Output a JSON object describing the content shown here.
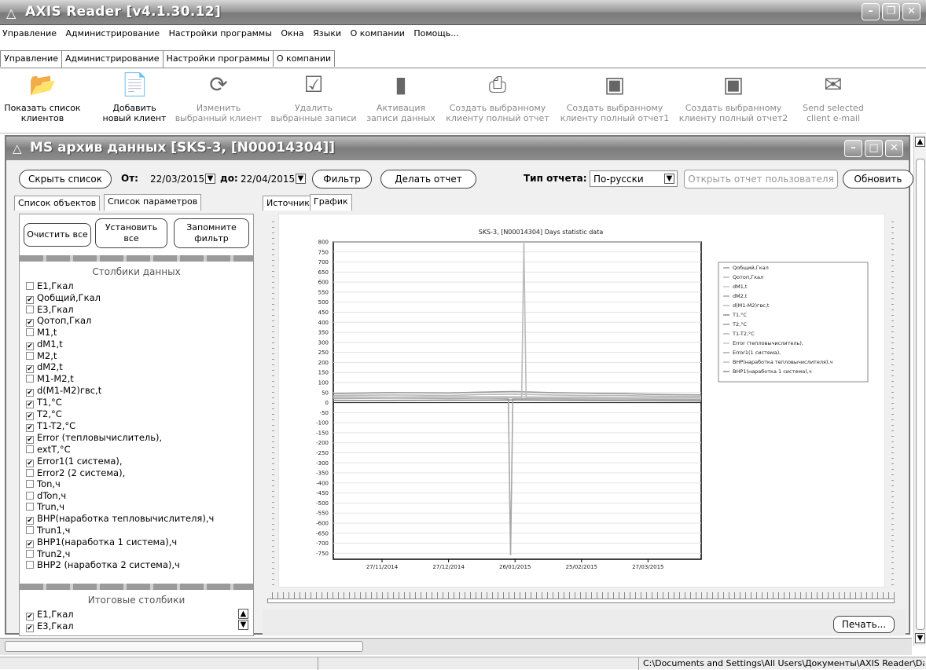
{
  "app": {
    "title": "AXIS Reader [v4.1.30.12]"
  },
  "menu": [
    "Управление",
    "Администрирование",
    "Настройки программы",
    "Окна",
    "Языки",
    "О компании",
    "Помощь..."
  ],
  "tabs": [
    "Управление",
    "Администрирование",
    "Настройки программы",
    "О компании"
  ],
  "ribbon": [
    {
      "l1": "Показать список",
      "l2": "клиентов",
      "icon": "folder-open-icon",
      "enabled": true
    },
    {
      "l1": "Добавить",
      "l2": "новый клиент",
      "icon": "document-add-icon",
      "enabled": true
    },
    {
      "l1": "Изменить",
      "l2": "выбранный клиент",
      "icon": "refresh-document-icon",
      "enabled": false
    },
    {
      "l1": "Удалить",
      "l2": "выбранные записи",
      "icon": "check-document-icon",
      "enabled": false
    },
    {
      "l1": "Активация",
      "l2": "записи данных",
      "icon": "activation-icon",
      "enabled": false
    },
    {
      "l1": "Создать выбранному",
      "l2": "клиенту полный отчет",
      "icon": "printer-icon",
      "enabled": false
    },
    {
      "l1": "Создать выбранному",
      "l2": "клиенту полный отчет1",
      "icon": "floppy-disk-icon",
      "enabled": false
    },
    {
      "l1": "Создать выбранному",
      "l2": "клиенту полный отчет2",
      "icon": "floppy-disk-icon",
      "enabled": false
    },
    {
      "l1": "Send selected",
      "l2": "client e-mail",
      "icon": "envelope-icon",
      "enabled": false
    }
  ],
  "child": {
    "title": "MS архив данных [SKS-3, [N00014304]]",
    "hide_list": "Скрыть список",
    "from_label": "От:",
    "from_date": "22/03/2015",
    "to_label": "до:",
    "to_date": "22/04/2015",
    "filter": "Фильтр",
    "make_report": "Делать отчет",
    "report_type_label": "Тип отчета:",
    "report_type": "По-русски",
    "open_user_report": "Открыть отчет пользователя",
    "refresh": "Обновить",
    "left_tabs": [
      "Список объектов",
      "Список параметров"
    ],
    "right_tabs": [
      "Источник",
      "График"
    ],
    "clear_all": "Очистить все",
    "set_all_1": "Установить",
    "set_all_2": "все",
    "remember_1": "Запомните",
    "remember_2": "фильтр",
    "data_columns_title": "Столбики данных",
    "params": [
      {
        "name": "E1,Гкал",
        "checked": false
      },
      {
        "name": "Qобщий,Гкал",
        "checked": true
      },
      {
        "name": "E3,Гкал",
        "checked": false
      },
      {
        "name": "Qотоп,Гкал",
        "checked": true
      },
      {
        "name": "M1,t",
        "checked": false
      },
      {
        "name": "dM1,t",
        "checked": true
      },
      {
        "name": "M2,t",
        "checked": false
      },
      {
        "name": "dM2,t",
        "checked": true
      },
      {
        "name": "M1-M2,t",
        "checked": false
      },
      {
        "name": "d(M1-M2)гвс,t",
        "checked": true
      },
      {
        "name": "T1,°C",
        "checked": true
      },
      {
        "name": "T2,°C",
        "checked": true
      },
      {
        "name": "T1-T2,°C",
        "checked": true
      },
      {
        "name": "Error (тепловычислитель),",
        "checked": true
      },
      {
        "name": "extT,°C",
        "checked": false
      },
      {
        "name": "Error1(1 система),",
        "checked": true
      },
      {
        "name": "Error2 (2 система),",
        "checked": false
      },
      {
        "name": "Ton,ч",
        "checked": false
      },
      {
        "name": "dTon,ч",
        "checked": false
      },
      {
        "name": "Trun,ч",
        "checked": false
      },
      {
        "name": "ВНР(наработка тепловычислителя),ч",
        "checked": true
      },
      {
        "name": "Trun1,ч",
        "checked": false
      },
      {
        "name": "ВНР1(наработка 1 система),ч",
        "checked": true
      },
      {
        "name": "Trun2,ч",
        "checked": false
      },
      {
        "name": "ВНР2 (наработка 2 система),ч",
        "checked": false
      }
    ],
    "totals_title": "Итоговые столбики",
    "totals": [
      {
        "name": "E1,Гкал",
        "checked": true
      },
      {
        "name": "E3,Гкал",
        "checked": true
      }
    ],
    "print": "Печать..."
  },
  "chart_data": {
    "type": "line",
    "title": "SKS-3, [N00014304] Days statistic data",
    "xlabel": "",
    "ylabel": "",
    "ylim": [
      -780,
      800
    ],
    "yticks": [
      800,
      750,
      700,
      650,
      600,
      550,
      500,
      450,
      400,
      350,
      300,
      250,
      200,
      150,
      100,
      50,
      0,
      -50,
      -100,
      -150,
      -200,
      -250,
      -300,
      -350,
      -400,
      -450,
      -500,
      -550,
      -600,
      -650,
      -700,
      -750
    ],
    "xtick_labels": [
      "27/11/2014",
      "27/12/2014",
      "26/01/2015",
      "25/02/2015",
      "27/03/2015"
    ],
    "xlim": [
      "2014-11-05",
      "2015-04-20"
    ],
    "grid": true,
    "legend_position": "right",
    "legend": [
      "Qобщий,Гкал",
      "Qотоп,Гкал",
      "dM1,t",
      "dM2,t",
      "d(M1-M2)гвс,t",
      "T1,°C",
      "T2,°C",
      "T1-T2,°C",
      "Error (тепловычислитель),",
      "Error1(1 система),",
      "ВНР(наработка тепловычислителя),ч",
      "ВНР1(наработка 1 система),ч"
    ],
    "series": [
      {
        "name": "T1,°C",
        "x": [
          "2014-11-05",
          "2014-12-01",
          "2014-12-27",
          "2015-01-10",
          "2015-01-26",
          "2015-02-10",
          "2015-02-25",
          "2015-03-15",
          "2015-04-01",
          "2015-04-20"
        ],
        "y": [
          45,
          50,
          48,
          52,
          55,
          50,
          47,
          45,
          40,
          38
        ]
      },
      {
        "name": "T2,°C",
        "x": [
          "2014-11-05",
          "2014-12-01",
          "2014-12-27",
          "2015-01-10",
          "2015-01-26",
          "2015-02-10",
          "2015-02-25",
          "2015-03-15",
          "2015-04-01",
          "2015-04-20"
        ],
        "y": [
          35,
          38,
          36,
          40,
          42,
          38,
          36,
          35,
          32,
          30
        ]
      },
      {
        "name": "dM1,t",
        "x": [
          "2014-11-05",
          "2014-12-01",
          "2014-12-27",
          "2015-01-10",
          "2015-01-20",
          "2015-01-26",
          "2015-02-10",
          "2015-02-25",
          "2015-03-15",
          "2015-04-01",
          "2015-04-20"
        ],
        "y": [
          30,
          28,
          32,
          30,
          30,
          30,
          28,
          28,
          25,
          25,
          22
        ]
      },
      {
        "name": "dM2,t",
        "x": [
          "2014-11-05",
          "2014-12-01",
          "2014-12-27",
          "2015-01-10",
          "2015-01-23",
          "2015-01-24",
          "2015-01-25",
          "2015-02-10",
          "2015-02-25",
          "2015-03-15",
          "2015-04-20"
        ],
        "y": [
          20,
          22,
          20,
          22,
          20,
          -760,
          20,
          20,
          18,
          18,
          15
        ]
      },
      {
        "name": "ВНР(наработка тепловычислителя),ч",
        "x": [
          "2014-11-05",
          "2015-01-29",
          "2015-01-30",
          "2015-01-31",
          "2015-04-20"
        ],
        "y": [
          24,
          24,
          800,
          24,
          24
        ]
      },
      {
        "name": "T1-T2,°C",
        "x": [
          "2014-11-05",
          "2014-12-27",
          "2015-01-26",
          "2015-02-25",
          "2015-04-20"
        ],
        "y": [
          10,
          12,
          13,
          11,
          8
        ]
      }
    ]
  },
  "status": {
    "path": "C:\\Documents and Settings\\All Users\\Документы\\AXIS Reader\\Da"
  }
}
